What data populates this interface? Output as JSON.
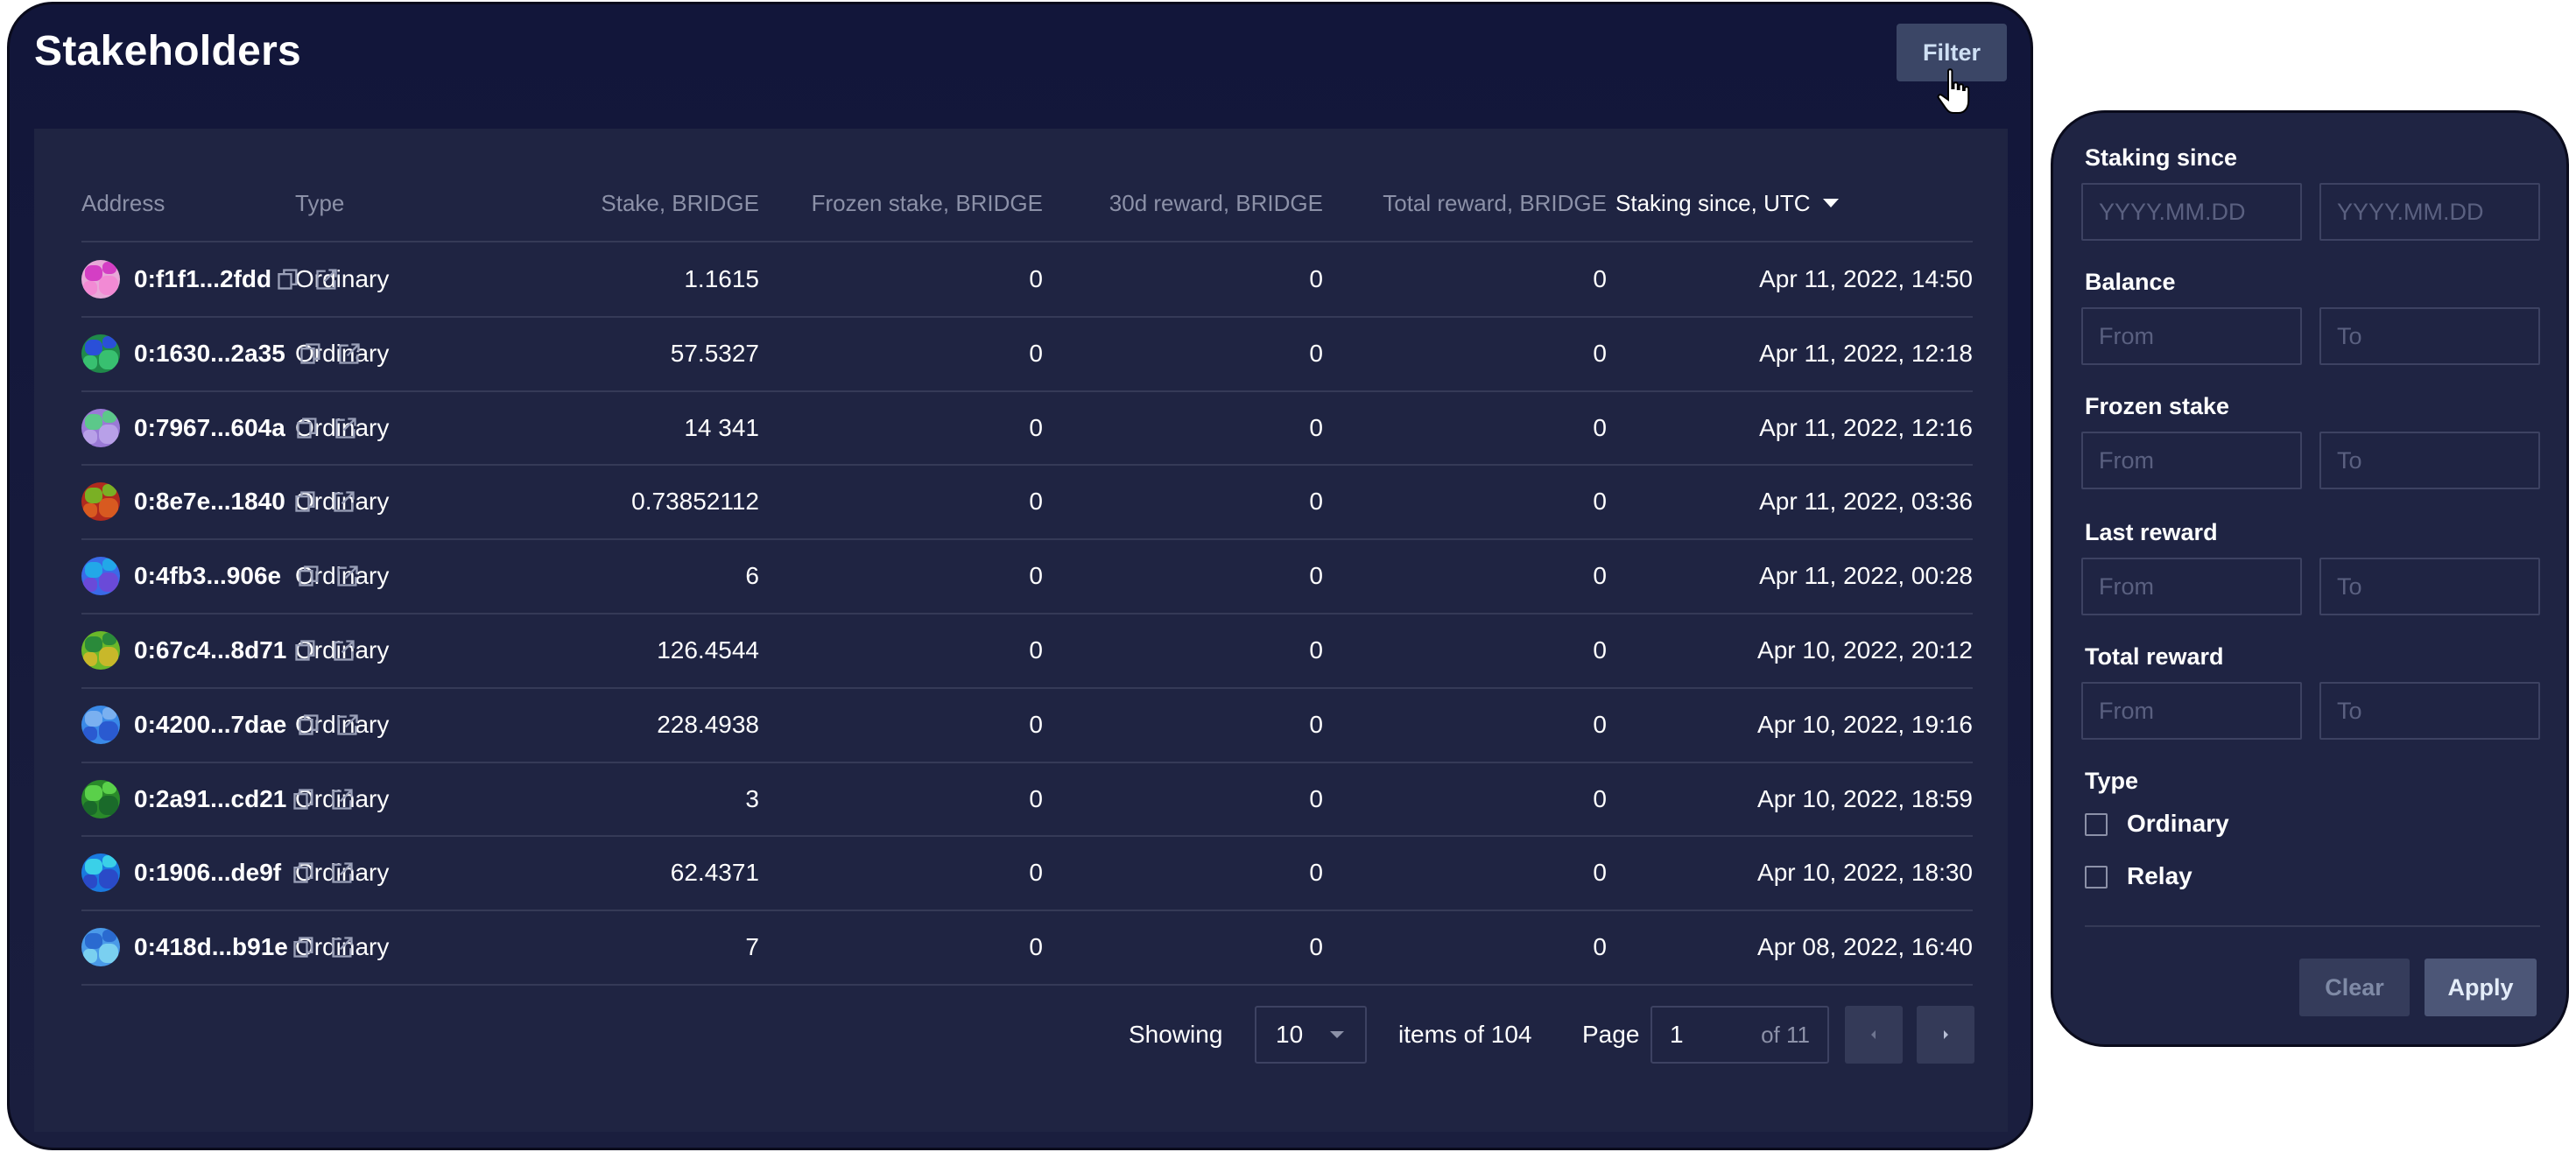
{
  "header": {
    "title": "Stakeholders",
    "filter_label": "Filter"
  },
  "table": {
    "columns": [
      "Address",
      "Type",
      "Stake, BRIDGE",
      "Frozen stake, BRIDGE",
      "30d reward, BRIDGE",
      "Total reward, BRIDGE",
      "Staking since, UTC"
    ],
    "sort_column": "Staking since, UTC",
    "sort_direction": "desc",
    "rows": [
      {
        "address": "0:f1f1...2fdd",
        "type": "Ordinary",
        "stake": "1.1615",
        "frozen": "0",
        "reward30d": "0",
        "total": "0",
        "since": "Apr 11, 2022, 14:50",
        "avatar": [
          "#e8a8d8",
          "#d43ec4",
          "#f28ad4"
        ]
      },
      {
        "address": "0:1630...2a35",
        "type": "Ordinary",
        "stake": "57.5327",
        "frozen": "0",
        "reward30d": "0",
        "total": "0",
        "since": "Apr 11, 2022, 12:18",
        "avatar": [
          "#1f8a4a",
          "#2a4fd8",
          "#38c070"
        ]
      },
      {
        "address": "0:7967...604a",
        "type": "Ordinary",
        "stake": "14 341",
        "frozen": "0",
        "reward30d": "0",
        "total": "0",
        "since": "Apr 11, 2022, 12:16",
        "avatar": [
          "#9a7ad6",
          "#5cc88a",
          "#b8a0e8"
        ]
      },
      {
        "address": "0:8e7e...1840",
        "type": "Ordinary",
        "stake": "0.73852112",
        "frozen": "0",
        "reward30d": "0",
        "total": "0",
        "since": "Apr 11, 2022, 03:36",
        "avatar": [
          "#b02a1e",
          "#7ab024",
          "#d85a20"
        ]
      },
      {
        "address": "0:4fb3...906e",
        "type": "Ordinary",
        "stake": "6",
        "frozen": "0",
        "reward30d": "0",
        "total": "0",
        "since": "Apr 11, 2022, 00:28",
        "avatar": [
          "#3a6ae8",
          "#22a8e8",
          "#6a4ad8"
        ]
      },
      {
        "address": "0:67c4...8d71",
        "type": "Ordinary",
        "stake": "126.4544",
        "frozen": "0",
        "reward30d": "0",
        "total": "0",
        "since": "Apr 10, 2022, 20:12",
        "avatar": [
          "#6ab82a",
          "#2a8a3a",
          "#c8b82a"
        ]
      },
      {
        "address": "0:4200...7dae",
        "type": "Ordinary",
        "stake": "228.4938",
        "frozen": "0",
        "reward30d": "0",
        "total": "0",
        "since": "Apr 10, 2022, 19:16",
        "avatar": [
          "#3a8ae8",
          "#7ab0f0",
          "#2a5ad0"
        ]
      },
      {
        "address": "0:2a91...cd21",
        "type": "Ordinary",
        "stake": "3",
        "frozen": "0",
        "reward30d": "0",
        "total": "0",
        "since": "Apr 10, 2022, 18:59",
        "avatar": [
          "#2a8a2a",
          "#5ad04a",
          "#1a6a2a"
        ]
      },
      {
        "address": "0:1906...de9f",
        "type": "Ordinary",
        "stake": "62.4371",
        "frozen": "0",
        "reward30d": "0",
        "total": "0",
        "since": "Apr 10, 2022, 18:30",
        "avatar": [
          "#1a7ae0",
          "#3ad0e8",
          "#2a4ac8"
        ]
      },
      {
        "address": "0:418d...b91e",
        "type": "Ordinary",
        "stake": "7",
        "frozen": "0",
        "reward30d": "0",
        "total": "0",
        "since": "Apr 08, 2022, 16:40",
        "avatar": [
          "#4a9ae8",
          "#2a6ad0",
          "#7ad0f0"
        ]
      }
    ]
  },
  "pagination": {
    "showing_label": "Showing",
    "page_size": "10",
    "items_of": "items of 104",
    "page_label": "Page",
    "page": "1",
    "of_pages": "of 11"
  },
  "filter_panel": {
    "staking_since": {
      "label": "Staking since",
      "from_placeholder": "YYYY.MM.DD",
      "to_placeholder": "YYYY.MM.DD"
    },
    "balance": {
      "label": "Balance",
      "from_placeholder": "From",
      "to_placeholder": "To"
    },
    "frozen_stake": {
      "label": "Frozen stake",
      "from_placeholder": "From",
      "to_placeholder": "To"
    },
    "last_reward": {
      "label": "Last reward",
      "from_placeholder": "From",
      "to_placeholder": "To"
    },
    "total_reward": {
      "label": "Total reward",
      "from_placeholder": "From",
      "to_placeholder": "To"
    },
    "type": {
      "label": "Type",
      "options": [
        {
          "label": "Ordinary",
          "checked": false
        },
        {
          "label": "Relay",
          "checked": false
        }
      ]
    },
    "clear_label": "Clear",
    "apply_label": "Apply"
  },
  "colors": {
    "panel_bg": "#1f2442",
    "header_bg": "#12163a",
    "muted_text": "#8c91a8",
    "button_bg": "#3b4666"
  }
}
